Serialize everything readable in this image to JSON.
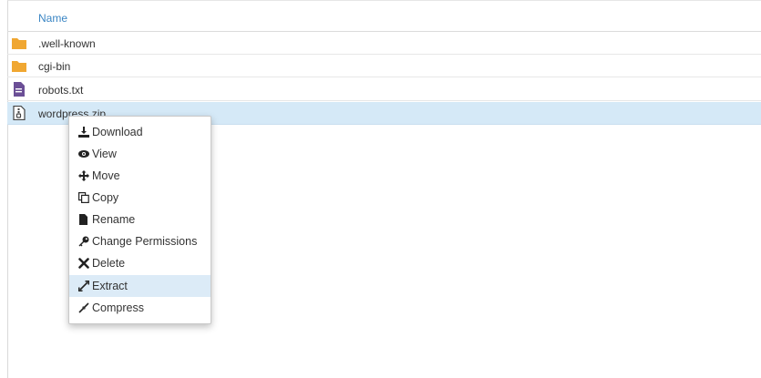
{
  "table": {
    "header": {
      "name_label": "Name"
    },
    "rows": [
      {
        "name": ".well-known",
        "icon": "folder-icon"
      },
      {
        "name": "cgi-bin",
        "icon": "folder-icon"
      },
      {
        "name": "robots.txt",
        "icon": "text-file-icon"
      },
      {
        "name": "wordpress.zip",
        "icon": "zip-file-icon",
        "selected": true
      }
    ]
  },
  "context_menu": {
    "items": [
      {
        "label": "Download",
        "icon": "download-icon"
      },
      {
        "label": "View",
        "icon": "eye-icon"
      },
      {
        "label": "Move",
        "icon": "move-icon"
      },
      {
        "label": "Copy",
        "icon": "copy-icon"
      },
      {
        "label": "Rename",
        "icon": "file-icon"
      },
      {
        "label": "Change Permissions",
        "icon": "key-icon"
      },
      {
        "label": "Delete",
        "icon": "close-icon"
      },
      {
        "label": "Extract",
        "icon": "expand-icon",
        "active": true
      },
      {
        "label": "Compress",
        "icon": "compress-icon"
      }
    ]
  },
  "colors": {
    "folder": "#f0a732",
    "file": "#6b4f96",
    "header_text": "#3b86c4",
    "selected_row": "#d5e9f7",
    "menu_hover": "#dcebf7"
  }
}
